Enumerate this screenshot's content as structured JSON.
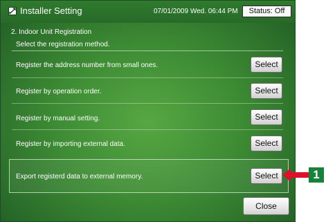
{
  "header": {
    "title": "Installer Setting",
    "datetime": "07/01/2009 Wed. 06:44 PM",
    "status": "Status: Off"
  },
  "panel": {
    "heading": "2. Indoor Unit Registration",
    "instruction": "Select the registration method."
  },
  "rows": [
    {
      "label": "Register the address number from small ones.",
      "button": "Select"
    },
    {
      "label": "Register by operation order.",
      "button": "Select"
    },
    {
      "label": "Register by manual setting.",
      "button": "Select"
    },
    {
      "label": "Register by importing external data.",
      "button": "Select"
    }
  ],
  "export": {
    "label": "Export registerd data to external memory.",
    "button": "Select"
  },
  "close_label": "Close",
  "callout": {
    "number": "1"
  },
  "colors": {
    "screen_green": "#3d8b34",
    "arrow_red": "#e0102a",
    "callout_green": "#16823a"
  },
  "icons": {
    "title_icon": "settings-edit-icon",
    "arrow": "left-arrow-icon"
  }
}
